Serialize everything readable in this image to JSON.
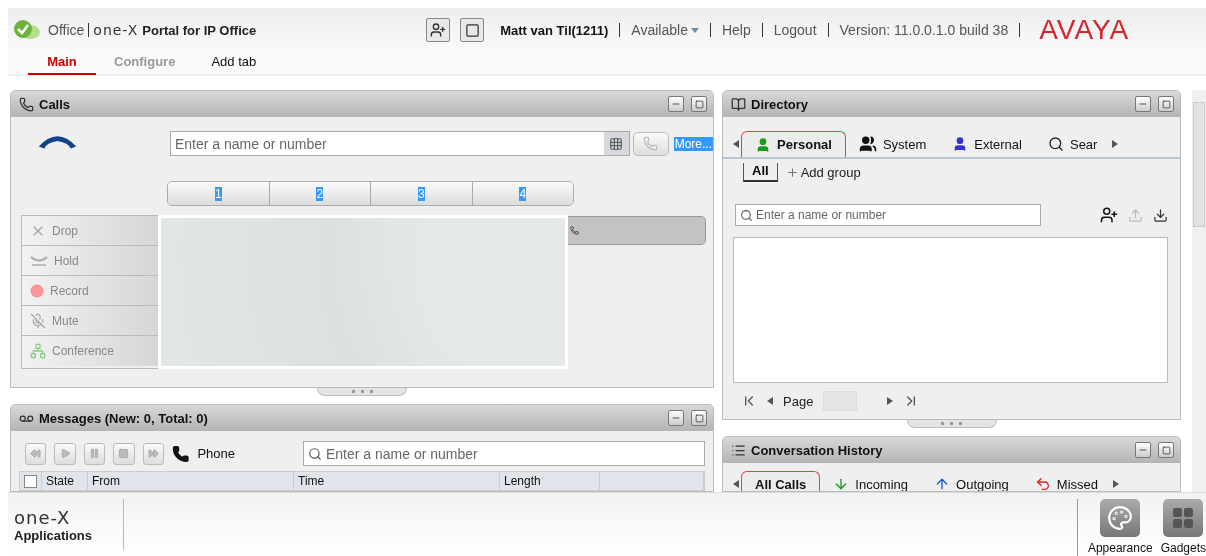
{
  "header": {
    "product": "Office",
    "logo": "one-X",
    "title": "Portal for IP Office",
    "user": "Matt van Til(1211)",
    "status": "Available",
    "links": [
      "Help",
      "Logout"
    ],
    "version": "Version: 11.0.0.1.0 build 38",
    "brand": "AVAYA"
  },
  "tabs": [
    {
      "label": "Main",
      "selected": true,
      "disabled": false
    },
    {
      "label": "Configure",
      "selected": false,
      "disabled": true
    },
    {
      "label": "Add tab",
      "selected": false,
      "disabled": false
    }
  ],
  "calls": {
    "title": "Calls",
    "placeholder": "Enter a name or number",
    "more": "More...",
    "lines": [
      "1",
      "2",
      "3",
      "4"
    ],
    "actions": [
      {
        "label": "Drop",
        "kind": "drop",
        "disabled": true
      },
      {
        "label": "Hold",
        "kind": "hold",
        "disabled": true
      },
      {
        "label": "Record",
        "kind": "record",
        "disabled": true
      },
      {
        "label": "Mute",
        "kind": "mute",
        "disabled": true
      },
      {
        "label": "Conference",
        "kind": "conference",
        "disabled": true
      }
    ]
  },
  "messages": {
    "title": "Messages (New: 0, Total: 0)",
    "phone": "Phone",
    "placeholder": "Enter a name or number",
    "select_all": {
      "checked": false
    },
    "columns": [
      "State",
      "From",
      "Time",
      "Length"
    ]
  },
  "directory": {
    "title": "Directory",
    "tabs": [
      {
        "label": "Personal",
        "kind": "personal",
        "selected": true
      },
      {
        "label": "System",
        "kind": "system",
        "selected": false
      },
      {
        "label": "External",
        "kind": "external",
        "selected": false
      },
      {
        "label": "Sear",
        "kind": "search",
        "selected": false
      }
    ],
    "groups": [
      {
        "label": "All",
        "selected": true
      }
    ],
    "add_group": "Add group",
    "placeholder": "Enter a name or number",
    "page_label": "Page"
  },
  "history": {
    "title": "Conversation History",
    "tabs": [
      {
        "label": "All Calls",
        "kind": "all",
        "selected": true
      },
      {
        "label": "Incoming",
        "kind": "incoming",
        "selected": false
      },
      {
        "label": "Outgoing",
        "kind": "outgoing",
        "selected": false
      },
      {
        "label": "Missed",
        "kind": "missed",
        "selected": false
      }
    ]
  },
  "footer": {
    "logo": "one-X",
    "label": "Applications",
    "apps": [
      {
        "label": "Appearance",
        "kind": "appearance"
      },
      {
        "label": "Gadgets",
        "kind": "gadgets"
      }
    ]
  }
}
